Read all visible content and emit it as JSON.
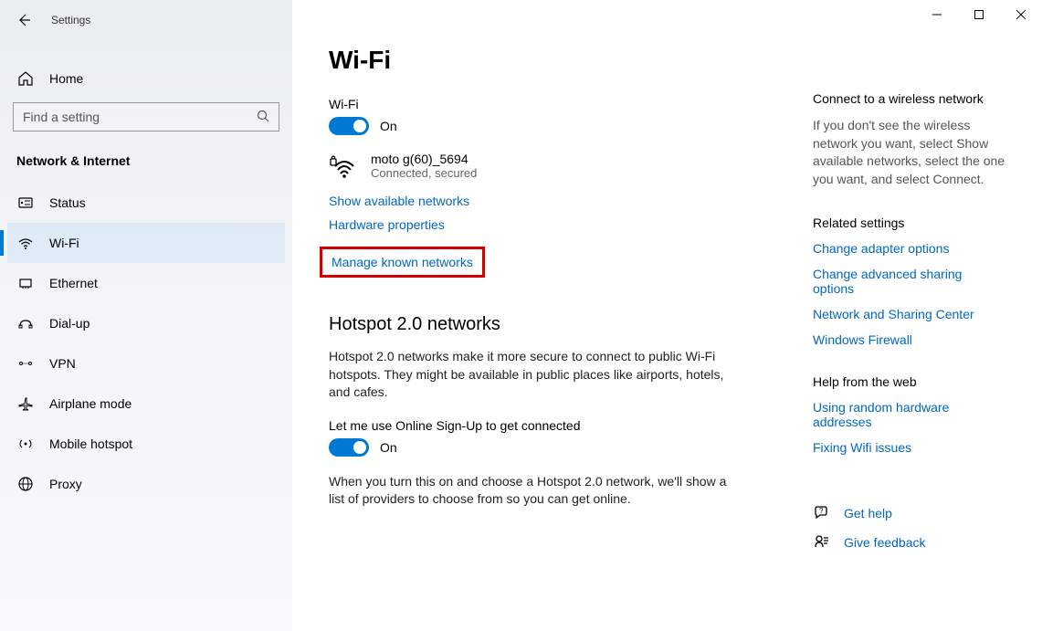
{
  "app_title": "Settings",
  "sidebar": {
    "home": "Home",
    "search_placeholder": "Find a setting",
    "category": "Network & Internet",
    "items": [
      {
        "label": "Status"
      },
      {
        "label": "Wi-Fi"
      },
      {
        "label": "Ethernet"
      },
      {
        "label": "Dial-up"
      },
      {
        "label": "VPN"
      },
      {
        "label": "Airplane mode"
      },
      {
        "label": "Mobile hotspot"
      },
      {
        "label": "Proxy"
      }
    ]
  },
  "main": {
    "title": "Wi-Fi",
    "wifi_label": "Wi-Fi",
    "wifi_toggle_state": "On",
    "network": {
      "name": "moto g(60)_5694",
      "status": "Connected, secured"
    },
    "link_show_available": "Show available networks",
    "link_hw_props": "Hardware properties",
    "link_manage_known": "Manage known networks",
    "hotspot_heading": "Hotspot 2.0 networks",
    "hotspot_desc": "Hotspot 2.0 networks make it more secure to connect to public Wi-Fi hotspots. They might be available in public places like airports, hotels, and cafes.",
    "hotspot_toggle_label": "Let me use Online Sign-Up to get connected",
    "hotspot_toggle_state": "On",
    "hotspot_footer": "When you turn this on and choose a Hotspot 2.0 network, we'll show a list of providers to choose from so you can get online."
  },
  "aside": {
    "connect_heading": "Connect to a wireless network",
    "connect_desc": "If you don't see the wireless network you want, select Show available networks, select the one you want, and select Connect.",
    "related_heading": "Related settings",
    "related_links": [
      "Change adapter options",
      "Change advanced sharing options",
      "Network and Sharing Center",
      "Windows Firewall"
    ],
    "help_heading": "Help from the web",
    "help_links": [
      "Using random hardware addresses",
      "Fixing Wifi issues"
    ],
    "get_help": "Get help",
    "give_feedback": "Give feedback"
  }
}
